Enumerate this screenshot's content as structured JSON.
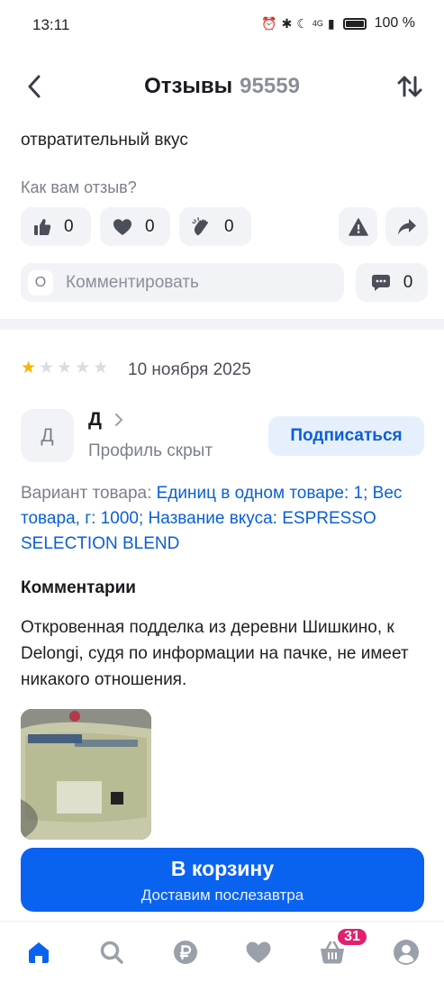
{
  "status_bar": {
    "time": "13:11",
    "network": "4G",
    "battery": "100 %"
  },
  "header": {
    "title": "Отзывы",
    "count": "95559",
    "back_icon": "chevron-left-icon",
    "sort_icon": "sort-arrows-icon"
  },
  "previous_review": {
    "text": "отвратительный вкус",
    "question": "Как вам отзыв?",
    "reactions": [
      {
        "icon": "thumbs-up-icon",
        "count": "0"
      },
      {
        "icon": "heart-icon",
        "count": "0"
      },
      {
        "icon": "clap-icon",
        "count": "0"
      }
    ],
    "report_icon": "warning-icon",
    "share_icon": "share-icon",
    "comment_avatar": "О",
    "comment_placeholder": "Комментировать",
    "comment_count": "0"
  },
  "review": {
    "rating": 1,
    "rating_max": 5,
    "date": "10 ноября 2025",
    "author_initial": "Д",
    "author_name": "Д",
    "author_sub": "Профиль скрыт",
    "subscribe_label": "Подписаться",
    "variant_label": "Вариант товара:",
    "variant_value": "Единиц в одном товаре: 1; Вес товара, г: 1000; Название вкуса: ESPRESSO SELECTION BLEND",
    "comments_heading": "Комментарии",
    "comment_text": "Откровенная подделка из деревни Шишкино, к Delongi,  судя по информации на пачке, не имеет никакого отношения."
  },
  "cart_button": {
    "label": "В корзину",
    "sublabel": "Доставим послезавтра"
  },
  "bottom_nav": {
    "items": [
      "home-icon",
      "search-icon",
      "ruble-icon",
      "heart-icon",
      "basket-icon",
      "profile-icon"
    ],
    "cart_badge": "31"
  },
  "colors": {
    "accent": "#0a63f0",
    "link": "#0a5fd6",
    "badge": "#e0216e",
    "star": "#f7b500",
    "chip_bg": "#f2f3f6"
  }
}
